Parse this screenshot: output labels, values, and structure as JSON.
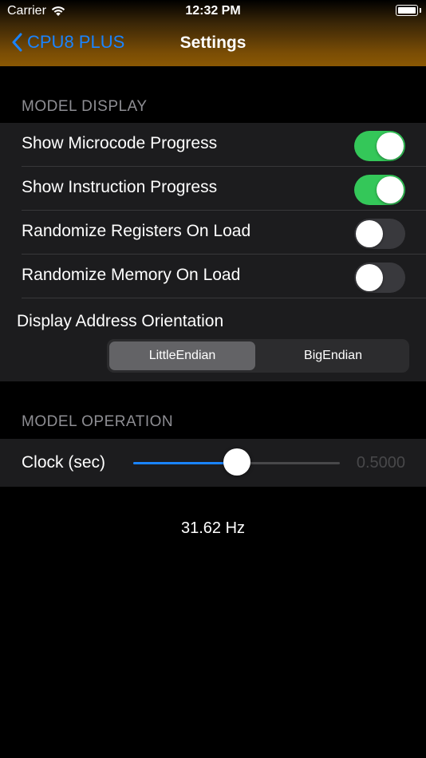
{
  "status_bar": {
    "carrier": "Carrier",
    "time": "12:32 PM"
  },
  "nav": {
    "back_label": "CPU8 PLUS",
    "title": "Settings"
  },
  "model_display": {
    "header": "MODEL DISPLAY",
    "toggles": [
      {
        "label": "Show Microcode Progress",
        "on": true
      },
      {
        "label": "Show Instruction Progress",
        "on": true
      },
      {
        "label": "Randomize Registers On Load",
        "on": false
      },
      {
        "label": "Randomize Memory On Load",
        "on": false
      }
    ],
    "orientation": {
      "label": "Display Address Orientation",
      "options": [
        "LittleEndian",
        "BigEndian"
      ],
      "selected": "LittleEndian"
    }
  },
  "model_operation": {
    "header": "MODEL OPERATION",
    "clock": {
      "label": "Clock (sec)",
      "value_text": "0.5000",
      "fraction": 0.5
    }
  },
  "frequency": "31.62 Hz",
  "colors": {
    "accent": "#1a84ff",
    "switch_on": "#34c759",
    "nav_bar": "#8a5803"
  }
}
